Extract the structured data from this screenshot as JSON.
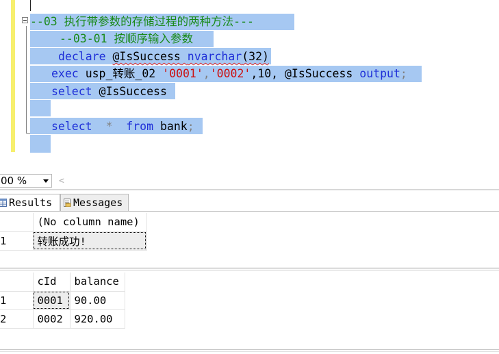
{
  "editor": {
    "lines": {
      "l1": "--03 执行带参数的存储过程的两种方法---",
      "l2": "--03-01 按顺序输入参数",
      "l3_kw": "declare",
      "l3_var": "@IsSuccess",
      "l3_type": "nvarchar",
      "l3_paren": "(32)",
      "l4_kw": "exec",
      "l4_proc": "usp_转账_02",
      "l4_arg1": "'0001'",
      "l4_comma1": ",",
      "l4_arg2": "'0002'",
      "l4_rest": ",10, @IsSuccess",
      "l4_output": "output",
      "l4_semi": ";",
      "l5_kw": "select",
      "l5_var": "@IsSuccess",
      "l7_kw": "select",
      "l7_star": "*",
      "l7_from": "from",
      "l7_table": "bank",
      "l7_semi": ";"
    }
  },
  "zoom": {
    "value": "00 %",
    "scroll_left": "<"
  },
  "tabs": {
    "results": "Results",
    "messages": "Messages"
  },
  "result1": {
    "header": "(No column name)",
    "rows": [
      {
        "num": "1",
        "value": "转账成功!"
      }
    ]
  },
  "result2": {
    "headers": [
      "cId",
      "balance"
    ],
    "rows": [
      {
        "num": "1",
        "cId": "0001",
        "balance": "90.00"
      },
      {
        "num": "2",
        "cId": "0002",
        "balance": "920.00"
      }
    ]
  },
  "colors": {
    "keyword": "#1f30d8",
    "comment": "#1a8a1a",
    "string": "#cc1010",
    "selection": "#a6c8f2"
  }
}
